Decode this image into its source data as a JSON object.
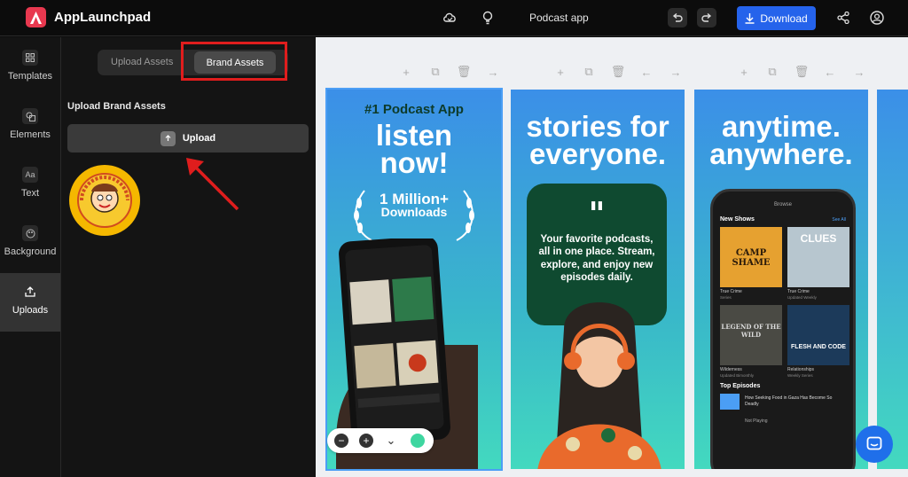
{
  "app": {
    "name": "AppLaunchpad",
    "project_name": "Podcast app"
  },
  "toolbar": {
    "download_label": "Download"
  },
  "nav": {
    "items": [
      {
        "label": "Templates",
        "icon": "templates-icon"
      },
      {
        "label": "Elements",
        "icon": "elements-icon"
      },
      {
        "label": "Text",
        "icon": "text-icon",
        "glyph": "Aa"
      },
      {
        "label": "Background",
        "icon": "background-icon"
      },
      {
        "label": "Uploads",
        "icon": "uploads-icon"
      }
    ],
    "active": "Uploads"
  },
  "panel": {
    "tabs": [
      "Upload Assets",
      "Brand Assets"
    ],
    "active_tab": "Brand Assets",
    "section_title": "Upload Brand Assets",
    "upload_button": "Upload"
  },
  "slides": [
    {
      "headline_top": "#1 Podcast App",
      "headline": [
        "listen",
        "now!"
      ],
      "badge": [
        "1 Million+",
        "Downloads"
      ]
    },
    {
      "headline": [
        "stories for",
        "everyone."
      ],
      "card_text": "Your favorite podcasts, all in one place. Stream, explore, and enjoy new episodes daily."
    },
    {
      "headline": [
        "anytime.",
        "anywhere."
      ],
      "phone": {
        "title": "Browse",
        "section": "New Shows",
        "see_all": "See All",
        "shows": [
          {
            "name": "CAMP SHAME",
            "caption": "True Crime",
            "sub": "Series"
          },
          {
            "name": "CLUES",
            "caption": "True Crime",
            "sub": "Updated Weekly"
          },
          {
            "name": "LEGEND OF THE WILD",
            "caption": "Wilderness",
            "sub": "Updated Bimonthly"
          },
          {
            "name": "FLESH AND CODE",
            "caption": "Relationships",
            "sub": "Weekly Series"
          }
        ],
        "episodes_title": "Top Episodes",
        "episode": "How Seeking Food in Gaza Has Become So Deadly",
        "now_playing": "Not Playing"
      }
    }
  ],
  "colors": {
    "accent": "#2563eb",
    "highlight": "#e01d1d",
    "logo": "#e8384f"
  }
}
